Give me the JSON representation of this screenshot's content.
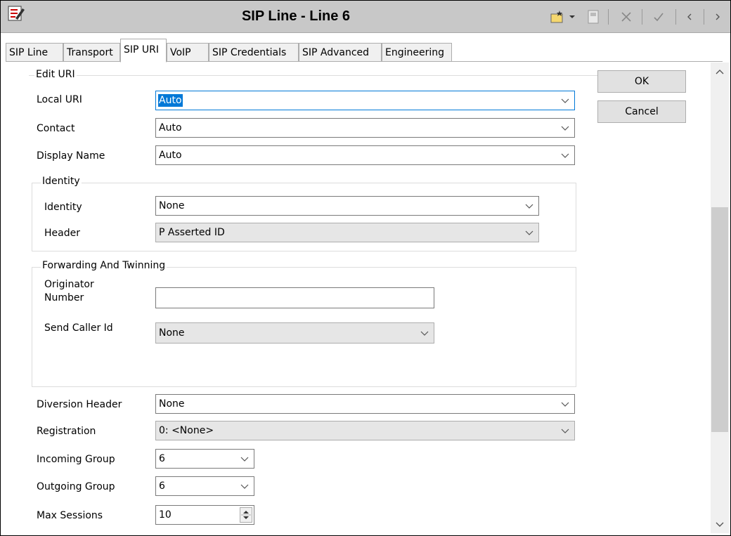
{
  "window": {
    "title": "SIP Line - Line 6"
  },
  "tabs": [
    "SIP Line",
    "Transport",
    "SIP URI",
    "VoIP",
    "SIP Credentials",
    "SIP Advanced",
    "Engineering"
  ],
  "edit_uri": {
    "legend": "Edit URI",
    "local_uri": {
      "label": "Local URI",
      "value": "Auto"
    },
    "contact": {
      "label": "Contact",
      "value": "Auto"
    },
    "display_name": {
      "label": "Display Name",
      "value": "Auto"
    }
  },
  "identity": {
    "legend": "Identity",
    "identity": {
      "label": "Identity",
      "value": "None"
    },
    "header": {
      "label": "Header",
      "value": "P Asserted ID"
    }
  },
  "forwarding": {
    "legend": "Forwarding And Twinning",
    "originator_label_1": "Originator",
    "originator_label_2": "Number",
    "originator_value": "",
    "send_caller_id": {
      "label": "Send Caller Id",
      "value": "None"
    }
  },
  "diversion_header": {
    "label": "Diversion Header",
    "value": "None"
  },
  "registration": {
    "label": "Registration",
    "value": "0: <None>"
  },
  "incoming_group": {
    "label": "Incoming Group",
    "value": "6"
  },
  "outgoing_group": {
    "label": "Outgoing Group",
    "value": "6"
  },
  "max_sessions": {
    "label": "Max Sessions",
    "value": "10"
  },
  "buttons": {
    "ok": "OK",
    "cancel": "Cancel"
  },
  "icons": {
    "app": "sip-line-config-icon",
    "new": "new-item-icon",
    "dropdown": "chevron-down-icon",
    "export": "export-icon",
    "delete": "close-icon",
    "validate": "check-icon",
    "previous": "chevron-left-icon",
    "next": "chevron-right-icon"
  }
}
